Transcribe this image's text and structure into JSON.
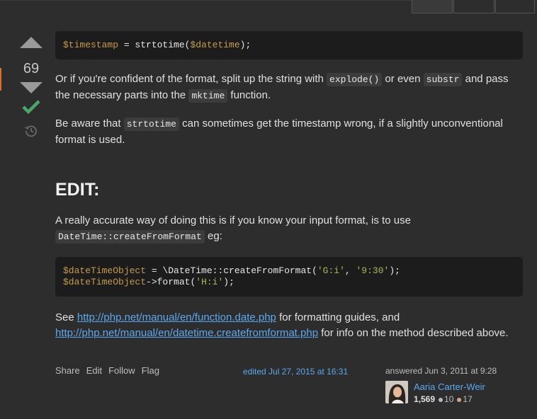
{
  "vote": {
    "count": "69"
  },
  "post": {
    "code1": {
      "var1": "$timestamp",
      "mid1": " = strtotime(",
      "var2": "$datetime",
      "end1": ");"
    },
    "p1": {
      "t1": "Or if you're confident of the format, split up the string with ",
      "c1": "explode()",
      "t2": " or even ",
      "c2": "substr",
      "t3": " and pass the necessary parts into the ",
      "c3": "mktime",
      "t4": " function."
    },
    "p2": {
      "t1": "Be aware that ",
      "c1": "strtotime",
      "t2": " can sometimes get the timestamp wrong, if a slightly unconventional format is used."
    },
    "heading": "EDIT:",
    "p3": {
      "t1": "A really accurate way of doing this is if you know your input format, is to use ",
      "c1": "DateTime::createFromFormat",
      "t2": " eg:"
    },
    "code2": {
      "var1": "$dateTimeObject",
      "mid1": " = \\DateTime::createFromFormat(",
      "str1": "'G:i'",
      "sep1": ", ",
      "str2": "'9:30'",
      "end1": ");",
      "var2": "$dateTimeObject",
      "mid2": "->format(",
      "str3": "'H:i'",
      "end2": ");"
    },
    "p4": {
      "t1": "See ",
      "link1": "http://php.net/manual/en/function.date.php",
      "t2": " for formatting guides, and ",
      "link2": "http://php.net/manual/en/datetime.createfromformat.php",
      "t3": " for info on the method described above."
    }
  },
  "menu": {
    "share": "Share",
    "edit": "Edit",
    "follow": "Follow",
    "flag": "Flag"
  },
  "edited": "edited Jul 27, 2015 at 16:31",
  "answered": "answered Jun 3, 2011 at 9:28",
  "user": {
    "name": "Aaria Carter-Weir",
    "rep": "1,569",
    "silver": "10",
    "bronze": "17"
  },
  "colors": {
    "accent": "#48a868",
    "link": "#5aa9f0",
    "silver": "#b4b8bc",
    "bronze": "#d1a684"
  }
}
